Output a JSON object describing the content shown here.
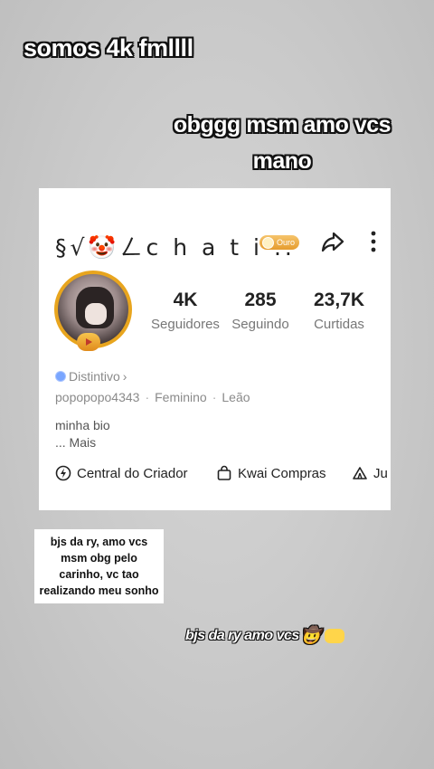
{
  "captions": {
    "top": "somos 4k fmllll",
    "right": "obggg msm amo vcs mano"
  },
  "profile": {
    "name": "§√🤡ㄥc h a t i ..",
    "badge_label": "Ouro",
    "stats": [
      {
        "value": "4K",
        "label": "Seguidores"
      },
      {
        "value": "285",
        "label": "Seguindo"
      },
      {
        "value": "23,7K",
        "label": "Curtidas"
      }
    ],
    "distintivo": "Distintivo",
    "username": "popopopo4343",
    "gender": "Feminino",
    "sign": "Leão",
    "bio": "minha bio",
    "more": "...  Mais",
    "tools": [
      {
        "label": "Central do Criador",
        "icon": "lightning-circle-icon"
      },
      {
        "label": "Kwai Compras",
        "icon": "shopping-bag-icon"
      },
      {
        "label": "Ju",
        "icon": "tent-icon"
      }
    ]
  },
  "note": "bjs da ry, amo vcs msm obg pelo carinho, vc tao realizando meu sonho",
  "bottom_caption": "bjs da ry amo vcs",
  "colors": {
    "gold": "#e8a51e",
    "badge": "#7aa6ff"
  }
}
